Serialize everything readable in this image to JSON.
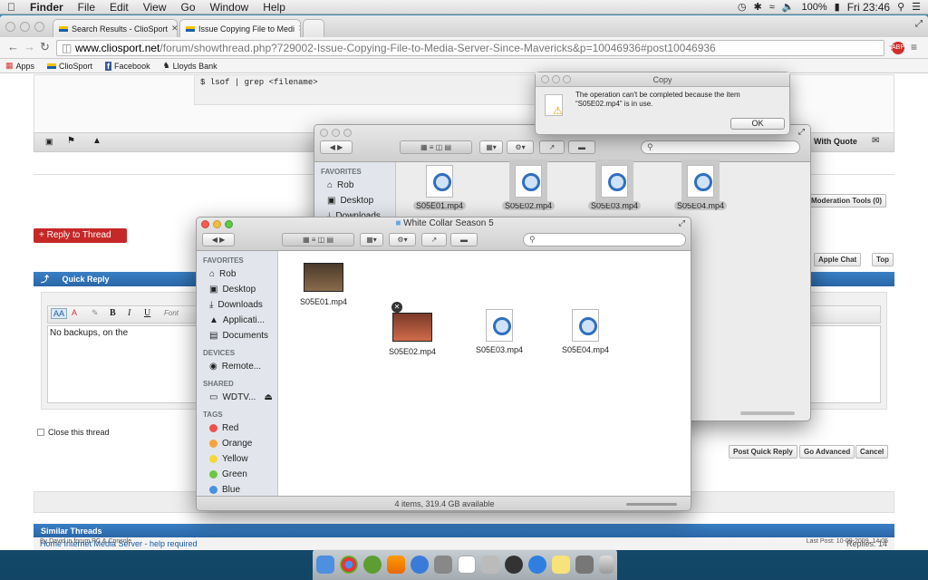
{
  "menubar": {
    "app": "Finder",
    "items": [
      "File",
      "Edit",
      "View",
      "Go",
      "Window",
      "Help"
    ],
    "battery": "100%",
    "clock": "Fri 23:46"
  },
  "browser": {
    "tabs": [
      {
        "label": "Search Results - ClioSport"
      },
      {
        "label": "Issue Copying File to Medi"
      }
    ],
    "url_host": "www.cliosport.net",
    "url_path": "/forum/showthread.php?729002-Issue-Copying-File-to-Media-Server-Since-Mavericks&p=10046936#post10046936",
    "bookmarks": [
      "Apps",
      "ClioSport",
      "Facebook",
      "Lloyds Bank"
    ]
  },
  "forum": {
    "code": "$ lsof | grep <filename>",
    "reply_with_quote": "With Quote",
    "moderation_tools": "Moderation Tools (0)",
    "reply_to_thread": "+ Reply to Thread",
    "apple_chat": "Apple Chat",
    "top": "Top",
    "quick_reply": "Quick Reply",
    "font_label": "Font",
    "reply_text": "No backups, on the",
    "close_thread": "Close this thread",
    "post_quick_reply": "Post Quick Reply",
    "go_advanced": "Go Advanced",
    "cancel": "Cancel",
    "similar_threads": "Similar Threads",
    "thread_title": "Home Internet Media Server - help required",
    "thread_by": "By David in forum PC & Console",
    "replies": "Replies: 14",
    "last_post": "Last Post: 10-09-2009, 14:05"
  },
  "finder_back": {
    "favorites_header": "FAVORITES",
    "favorites": [
      "Rob",
      "Desktop",
      "Downloads"
    ],
    "files": [
      "S05E01.mp4",
      "S05E02.mp4",
      "S05E03.mp4",
      "S05E04.mp4"
    ]
  },
  "finder_front": {
    "title": "White Collar Season 5",
    "favorites_header": "FAVORITES",
    "favorites": [
      "Rob",
      "Desktop",
      "Downloads",
      "Applicati...",
      "Documents"
    ],
    "devices_header": "DEVICES",
    "devices": [
      "Remote..."
    ],
    "shared_header": "SHARED",
    "shared": [
      "WDTV..."
    ],
    "tags_header": "TAGS",
    "tags": [
      {
        "name": "Red",
        "color": "#f0504a"
      },
      {
        "name": "Orange",
        "color": "#f5a33b"
      },
      {
        "name": "Yellow",
        "color": "#f5d63a"
      },
      {
        "name": "Green",
        "color": "#6cc644"
      },
      {
        "name": "Blue",
        "color": "#4a90e2"
      }
    ],
    "files": [
      "S05E01.mp4",
      "S05E02.mp4",
      "S05E03.mp4",
      "S05E04.mp4"
    ],
    "status": "4 items, 319.4 GB available"
  },
  "dialog": {
    "title": "Copy",
    "message": "The operation can't be completed because the item “S05E02.mp4” is in use.",
    "ok": "OK"
  }
}
